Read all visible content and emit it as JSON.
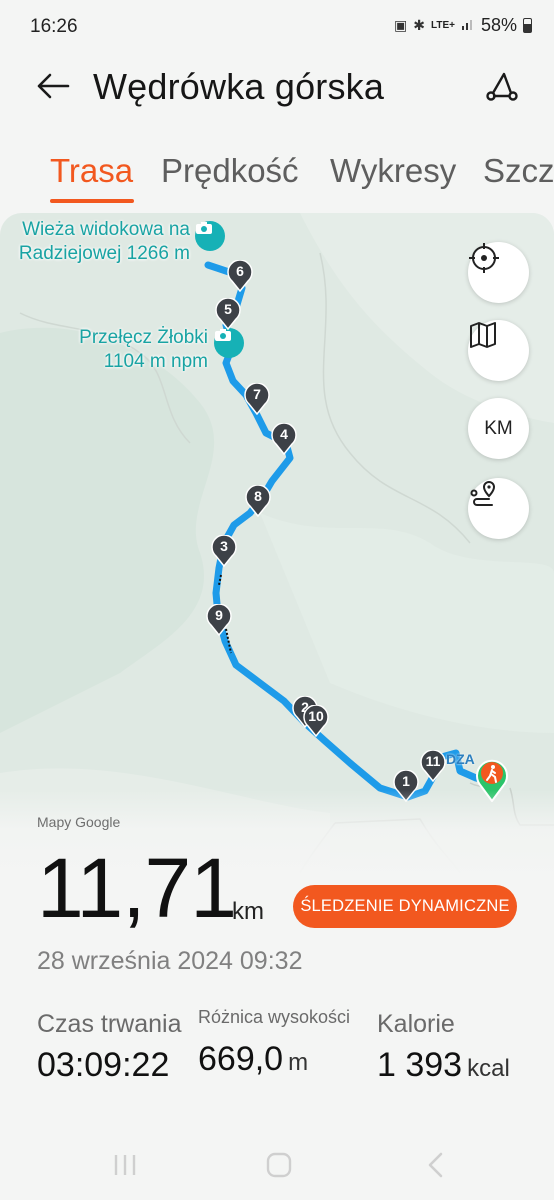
{
  "status_bar": {
    "time": "16:26",
    "network": "LTE+",
    "battery": "58%"
  },
  "header": {
    "title": "Wędrówka górska",
    "back_icon": "arrow-left-icon",
    "route_icon": "route-edit-icon"
  },
  "tabs": [
    {
      "label": "Trasa",
      "active": true
    },
    {
      "label": "Prędkość",
      "active": false
    },
    {
      "label": "Wykresy",
      "active": false
    },
    {
      "label": "Szcz",
      "active": false
    }
  ],
  "map": {
    "poi": [
      {
        "name": "Wieża widokowa na Radziejowej 1266 m",
        "line1": "Wieża widokowa na",
        "line2": "Radziejowej 1266 m"
      },
      {
        "name": "Przełęcz Żłobki 1104 m npm",
        "line1": "Przełęcz Żłobki",
        "line2": "1104 m npm"
      }
    ],
    "markers": [
      "6",
      "5",
      "7",
      "4",
      "8",
      "3",
      "9",
      "2",
      "10",
      "1",
      "11"
    ],
    "start_label": "DZA",
    "controls": {
      "locate_icon": "crosshair-icon",
      "layers_icon": "map-icon",
      "units_label": "KM",
      "route_icon": "route-pin-icon"
    },
    "attribution": "Mapy Google",
    "route_color": "#1e9be9",
    "accent_color": "#f2581f"
  },
  "summary": {
    "distance_value": "11,71",
    "distance_unit": "km",
    "live_tracking_button": "ŚLEDZENIE DYNAMICZNE",
    "date": "28 września 2024 09:32",
    "stats": [
      {
        "label": "Czas trwania",
        "value": "03:09:22",
        "unit": ""
      },
      {
        "label": "Różnica wysokości",
        "value": "669,0",
        "unit": "m"
      },
      {
        "label": "Kalorie",
        "value": "1 393",
        "unit": "kcal"
      }
    ]
  },
  "nav_bar": {
    "recent_icon": "recent-apps-icon",
    "home_icon": "home-icon",
    "back_icon": "back-chevron-icon"
  }
}
